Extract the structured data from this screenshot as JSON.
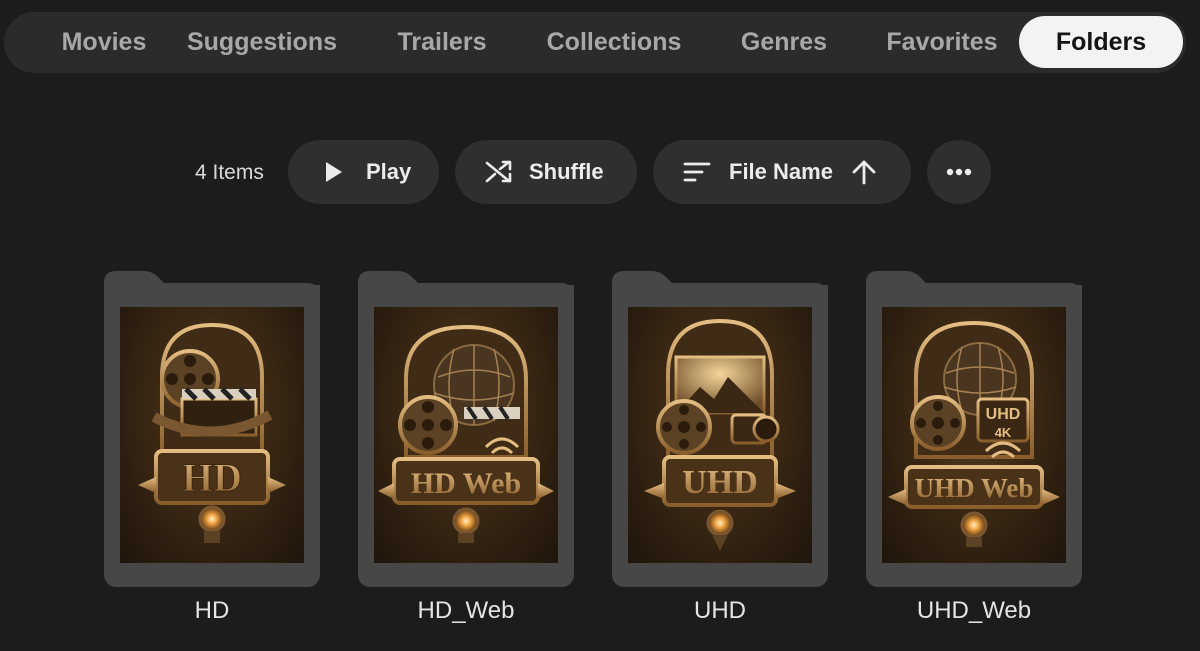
{
  "tabs": [
    {
      "label": "Movies",
      "active": false
    },
    {
      "label": "Suggestions",
      "active": false
    },
    {
      "label": "Trailers",
      "active": false
    },
    {
      "label": "Collections",
      "active": false
    },
    {
      "label": "Genres",
      "active": false
    },
    {
      "label": "Favorites",
      "active": false
    },
    {
      "label": "Folders",
      "active": true
    }
  ],
  "toolbar": {
    "item_count": "4 Items",
    "play_label": "Play",
    "shuffle_label": "Shuffle",
    "sort_label": "File Name",
    "sort_direction": "ascending",
    "icons": {
      "play": "play-icon",
      "shuffle": "shuffle-icon",
      "sort": "sort-lines-icon",
      "direction": "arrow-up-icon",
      "more": "more-dots-icon"
    }
  },
  "folders": [
    {
      "name": "HD",
      "art_text": "HD"
    },
    {
      "name": "HD_Web",
      "art_text": "HD Web"
    },
    {
      "name": "UHD",
      "art_text": "UHD"
    },
    {
      "name": "UHD_Web",
      "art_text": "UHD Web",
      "badge_top": "UHD",
      "badge_bottom": "4K"
    }
  ],
  "colors": {
    "background": "#1c1c1c",
    "tabbar": "#2b2b2b",
    "active_tab": "#f3f3f3",
    "pill": "#2f2f2f",
    "folder": "#474747",
    "art_gold": "#c89a5c"
  }
}
